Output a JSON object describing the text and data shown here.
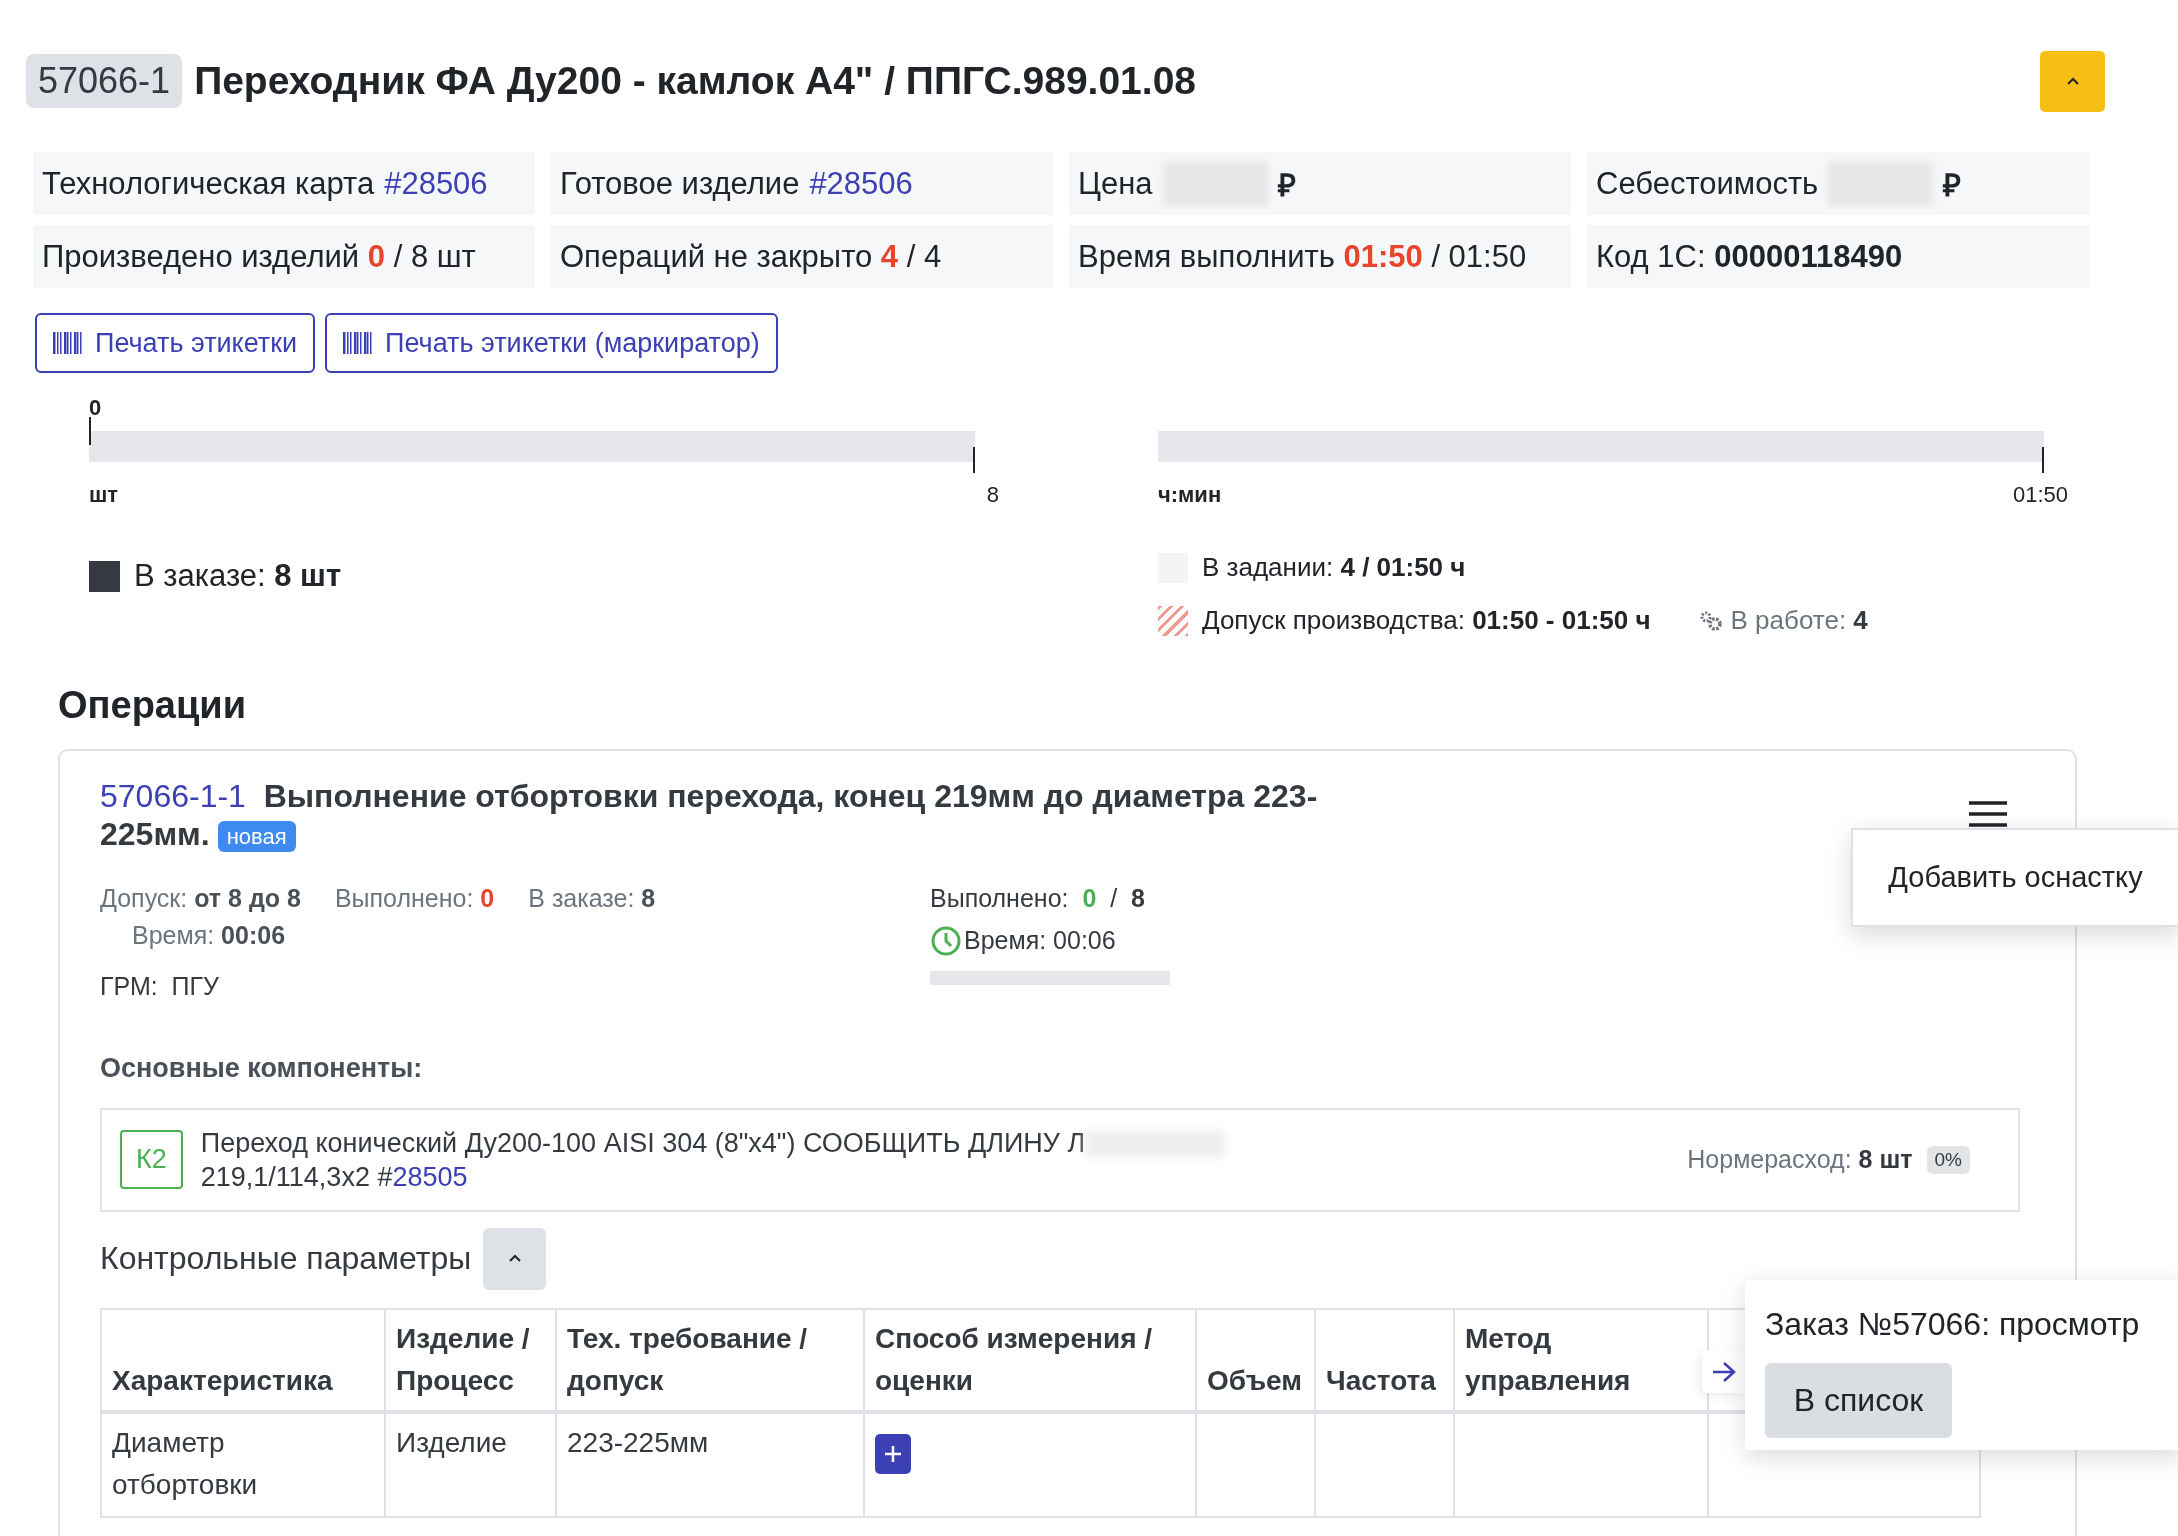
{
  "header": {
    "code": "57066-1",
    "title": "Переходник ФА Ду200 - камлок А4\" / ППГС.989.01.08"
  },
  "info": [
    {
      "kind": "link",
      "label": "Технологическая карта",
      "value": "#28506"
    },
    {
      "kind": "link",
      "label": "Готовое изделие",
      "value": "#28506"
    },
    {
      "kind": "redacted",
      "label": "Цена",
      "unit": "₽"
    },
    {
      "kind": "redacted",
      "label": "Себестоимость",
      "unit": "₽"
    },
    {
      "kind": "ratio",
      "label": "Произведено изделий",
      "value": "0",
      "rest": "/ 8 шт"
    },
    {
      "kind": "ratio",
      "label": "Операций не закрыто",
      "value": "4",
      "rest": "/ 4"
    },
    {
      "kind": "ratio",
      "label": "Время выполнить",
      "value": "01:50",
      "rest": "/ 01:50"
    },
    {
      "kind": "code",
      "label": "Код 1С:",
      "value": "00000118490"
    }
  ],
  "print_buttons": [
    "Печать этикетки",
    "Печать этикетки (маркиратор)"
  ],
  "progress": [
    {
      "start": "0",
      "unit": "шт",
      "end": "8",
      "level": 0
    },
    {
      "unit": "ч:мин",
      "end": "01:50",
      "level": 0
    }
  ],
  "legend_left": [
    {
      "kind": "solid",
      "label": "В заказе:",
      "value": "8 шт"
    }
  ],
  "legend_right": [
    {
      "kind": "light",
      "label": "В задании:",
      "value": "4 / 01:50 ч"
    },
    {
      "kind": "hatched",
      "label": "Допуск производства:",
      "value": "01:50 - 01:50 ч"
    }
  ],
  "in_work": {
    "label": "В работе:",
    "value": "4"
  },
  "section_title": "Операции",
  "operation": {
    "code": "57066-1-1",
    "title": "Выполнение отбортовки перехода, конец 219мм до диаметра 223-225мм.",
    "status": "новая",
    "stats": [
      {
        "kind": "plain",
        "label": "Допуск:",
        "value": "от 8 до 8"
      },
      {
        "kind": "alert",
        "label": "Выполнено:",
        "value": "0"
      },
      {
        "kind": "plain",
        "label": "В заказе:",
        "value": "8"
      },
      {
        "kind": "indent",
        "label": "Время:",
        "value": "00:06"
      }
    ],
    "grm": {
      "label": "ГРМ:",
      "value": "ПГУ"
    },
    "done": {
      "label": "Выполнено:",
      "value": "0",
      "separator": "/",
      "total": "8"
    },
    "time": "Время: 00:06",
    "level": 0,
    "menu": [
      "Добавить оснастку"
    ],
    "components_title": "Основные компоненты:",
    "component": {
      "badge": "К2",
      "name": "Переход конический Ду200-100 AISI 304 (8\"x4\") СООБЩИТЬ ДЛИНУ Л",
      "size": "219,1/114,3x2 #",
      "link": "28505",
      "norm_label": "Нормерасход:",
      "norm_value": "8 шт",
      "percent": "0%"
    },
    "params_title": "Контрольные параметры",
    "table": {
      "columns": [
        "Характеристика",
        "Изделие / Процесс",
        "Тех. требование / допуск",
        "Способ измерения / оценки",
        "Объем",
        "Частота",
        "Метод управления"
      ],
      "rows": [
        {
          "characteristic": "Диаметр отбортовки",
          "scope": "Изделие",
          "requirement": "223-225мм",
          "measure": {
            "kind": "add"
          }
        }
      ]
    }
  },
  "popup": {
    "title": "Заказ №57066: просмотр",
    "button": "В список"
  }
}
